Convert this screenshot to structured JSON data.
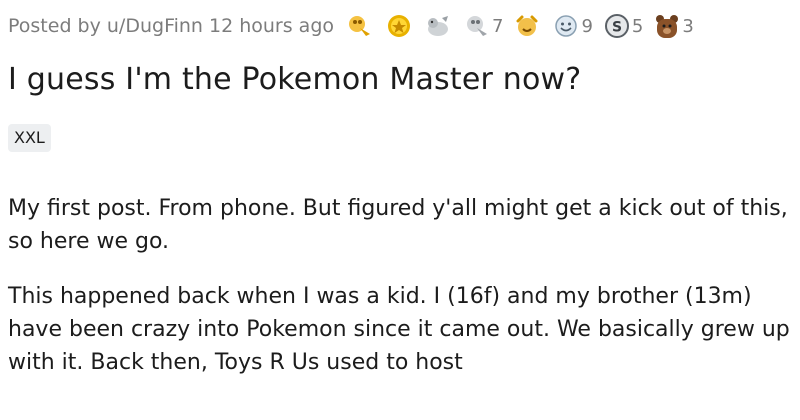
{
  "post": {
    "byline": "Posted by u/DugFinn 12 hours ago",
    "awards": [
      {
        "icon": "helpful-award-icon",
        "count": ""
      },
      {
        "icon": "gold-award-icon",
        "count": ""
      },
      {
        "icon": "wholesome-seal-award-icon",
        "count": ""
      },
      {
        "icon": "helpful-award-icon",
        "count": "7"
      },
      {
        "icon": "take-my-energy-award-icon",
        "count": ""
      },
      {
        "icon": "wholesome-award-icon",
        "count": "9"
      },
      {
        "icon": "coin-award-icon",
        "count": "5"
      },
      {
        "icon": "bear-award-icon",
        "count": "3"
      }
    ],
    "title": "I guess I'm the Pokemon Master now?",
    "flair": "XXL",
    "body_paragraphs": [
      "My first post. From phone. But figured y'all might get a kick out of this, so here we go.",
      "This happened back when I was a kid. I (16f) and my brother (13m) have been crazy into Pokemon since it came out. We basically grew up with it. Back then, Toys R Us used to host"
    ]
  }
}
